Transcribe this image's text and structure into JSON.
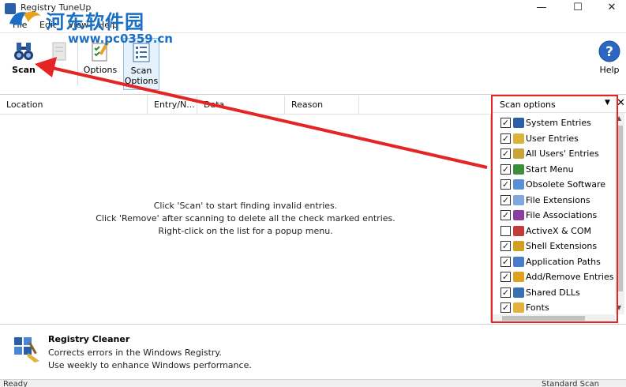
{
  "window": {
    "title": "Registry TuneUp",
    "minimize_glyph": "—",
    "maximize_glyph": "☐",
    "close_glyph": "✕"
  },
  "watermark": {
    "text": "河东软件园",
    "url": "www.pc0359.cn"
  },
  "menu": [
    {
      "label": "File"
    },
    {
      "label": "Edit"
    },
    {
      "label": "View"
    },
    {
      "label": "Help"
    }
  ],
  "toolbar": {
    "scan_label": "Scan",
    "options_label": "Options",
    "scan_options_label": "Scan Options",
    "help_label": "Help"
  },
  "list": {
    "columns": [
      "Location",
      "Entry/N...",
      "Data",
      "Reason"
    ],
    "hints": [
      "Click 'Scan' to start finding invalid entries.",
      "Click 'Remove' after scanning to delete all the check marked entries.",
      "Right-click on the list for a popup menu."
    ]
  },
  "scan_options": {
    "title": "Scan options",
    "items": [
      {
        "label": "System Entries",
        "checked": true,
        "icon": "system-entries-icon",
        "color": "#2b5ea7"
      },
      {
        "label": "User Entries",
        "checked": true,
        "icon": "user-entries-icon",
        "color": "#d9b43a"
      },
      {
        "label": "All Users' Entries",
        "checked": true,
        "icon": "all-users-icon",
        "color": "#c9a43b"
      },
      {
        "label": "Start Menu",
        "checked": true,
        "icon": "start-menu-icon",
        "color": "#3c8d3c"
      },
      {
        "label": "Obsolete Software",
        "checked": true,
        "icon": "obsolete-software-icon",
        "color": "#5a8fd6"
      },
      {
        "label": "File Extensions",
        "checked": true,
        "icon": "file-extensions-icon",
        "color": "#7fa7e0"
      },
      {
        "label": "File Associations",
        "checked": true,
        "icon": "file-associations-icon",
        "color": "#8a3fa0"
      },
      {
        "label": "ActiveX & COM",
        "checked": false,
        "icon": "activex-icon",
        "color": "#c23b3b"
      },
      {
        "label": "Shell Extensions",
        "checked": true,
        "icon": "shell-extensions-icon",
        "color": "#d2a021"
      },
      {
        "label": "Application Paths",
        "checked": true,
        "icon": "application-paths-icon",
        "color": "#4a7cc7"
      },
      {
        "label": "Add/Remove Entries",
        "checked": true,
        "icon": "add-remove-icon",
        "color": "#e0a020"
      },
      {
        "label": "Shared DLLs",
        "checked": true,
        "icon": "shared-dlls-icon",
        "color": "#3a6fb0"
      },
      {
        "label": "Fonts",
        "checked": true,
        "icon": "fonts-icon",
        "color": "#e3b23c"
      }
    ]
  },
  "description": {
    "title": "Registry Cleaner",
    "line1": "Corrects errors in the Windows Registry.",
    "line2": "Use weekly to enhance Windows performance."
  },
  "status": {
    "left": "Ready",
    "right": "Standard Scan"
  },
  "colors": {
    "accent": "#1a6fc4",
    "annotation_red": "#e52424",
    "selected_button": "#e5f1fb"
  }
}
